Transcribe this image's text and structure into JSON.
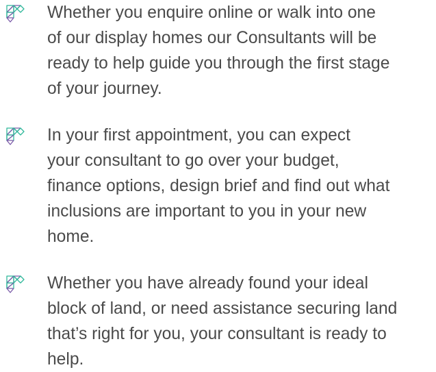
{
  "bullet_icon": "geometric-triangles-logo-icon",
  "accent_color": "#2fb89a",
  "secondary_color": "#7a5aa8",
  "text_color": "#4a4a4a",
  "items": [
    {
      "text": "Whether you enquire online or walk into one\nof our display homes our Consultants will be\nready to help guide you through the first stage\nof your journey."
    },
    {
      "text": "In your first appointment, you can expect\nyour consultant to go over your budget,\nfinance options, design brief and find out what\ninclusions are important to you in your new\nhome."
    },
    {
      "text": "Whether you have already found your ideal\nblock of land, or need assistance securing land\nthat’s right for you, your consultant is ready to\nhelp."
    }
  ]
}
